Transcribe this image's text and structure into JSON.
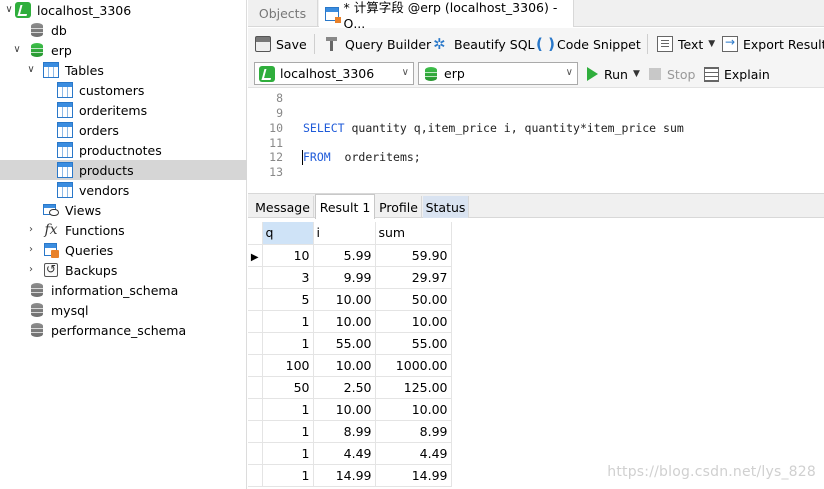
{
  "sidebar": {
    "nodes": [
      {
        "label": "localhost_3306",
        "icon": "connection-icon"
      },
      {
        "label": "db",
        "icon": "database-icon"
      },
      {
        "label": "erp",
        "icon": "database-icon"
      },
      {
        "label": "Tables",
        "icon": "tables-icon"
      },
      {
        "label": "customers",
        "icon": "table-icon"
      },
      {
        "label": "orderitems",
        "icon": "table-icon"
      },
      {
        "label": "orders",
        "icon": "table-icon"
      },
      {
        "label": "productnotes",
        "icon": "table-icon"
      },
      {
        "label": "products",
        "icon": "table-icon"
      },
      {
        "label": "vendors",
        "icon": "table-icon"
      },
      {
        "label": "Views",
        "icon": "views-icon"
      },
      {
        "label": "Functions",
        "icon": "functions-icon"
      },
      {
        "label": "Queries",
        "icon": "queries-icon"
      },
      {
        "label": "Backups",
        "icon": "backups-icon"
      },
      {
        "label": "information_schema",
        "icon": "database-icon"
      },
      {
        "label": "mysql",
        "icon": "database-icon"
      },
      {
        "label": "performance_schema",
        "icon": "database-icon"
      }
    ]
  },
  "tabs": {
    "objects": "Objects",
    "query": "* 计算字段 @erp (localhost_3306) - Q..."
  },
  "toolbar": {
    "save": "Save",
    "query_builder": "Query Builder",
    "beautify": "Beautify SQL",
    "snippet": "Code Snippet",
    "text": "Text",
    "export": "Export Result"
  },
  "connbar": {
    "connection": "localhost_3306",
    "database": "erp",
    "run": "Run",
    "stop": "Stop",
    "explain": "Explain"
  },
  "editor": {
    "lines": [
      {
        "num": "8",
        "code": ""
      },
      {
        "num": "9",
        "code": ""
      },
      {
        "num": "10",
        "code": "SELECT quantity q,item_price i, quantity*item_price sum"
      },
      {
        "num": "11",
        "code": ""
      },
      {
        "num": "12",
        "code": "FROM  orderitems;"
      },
      {
        "num": "13",
        "code": ""
      }
    ]
  },
  "result_tabs": [
    "Message",
    "Result 1",
    "Profile",
    "Status"
  ],
  "grid": {
    "columns": [
      "q",
      "i",
      "sum"
    ],
    "rows": [
      [
        "10",
        "5.99",
        "59.90"
      ],
      [
        "3",
        "9.99",
        "29.97"
      ],
      [
        "5",
        "10.00",
        "50.00"
      ],
      [
        "1",
        "10.00",
        "10.00"
      ],
      [
        "1",
        "55.00",
        "55.00"
      ],
      [
        "100",
        "10.00",
        "1000.00"
      ],
      [
        "50",
        "2.50",
        "125.00"
      ],
      [
        "1",
        "10.00",
        "10.00"
      ],
      [
        "1",
        "8.99",
        "8.99"
      ],
      [
        "1",
        "4.49",
        "4.49"
      ],
      [
        "1",
        "14.99",
        "14.99"
      ]
    ]
  },
  "watermark": "https://blog.csdn.net/lys_828"
}
